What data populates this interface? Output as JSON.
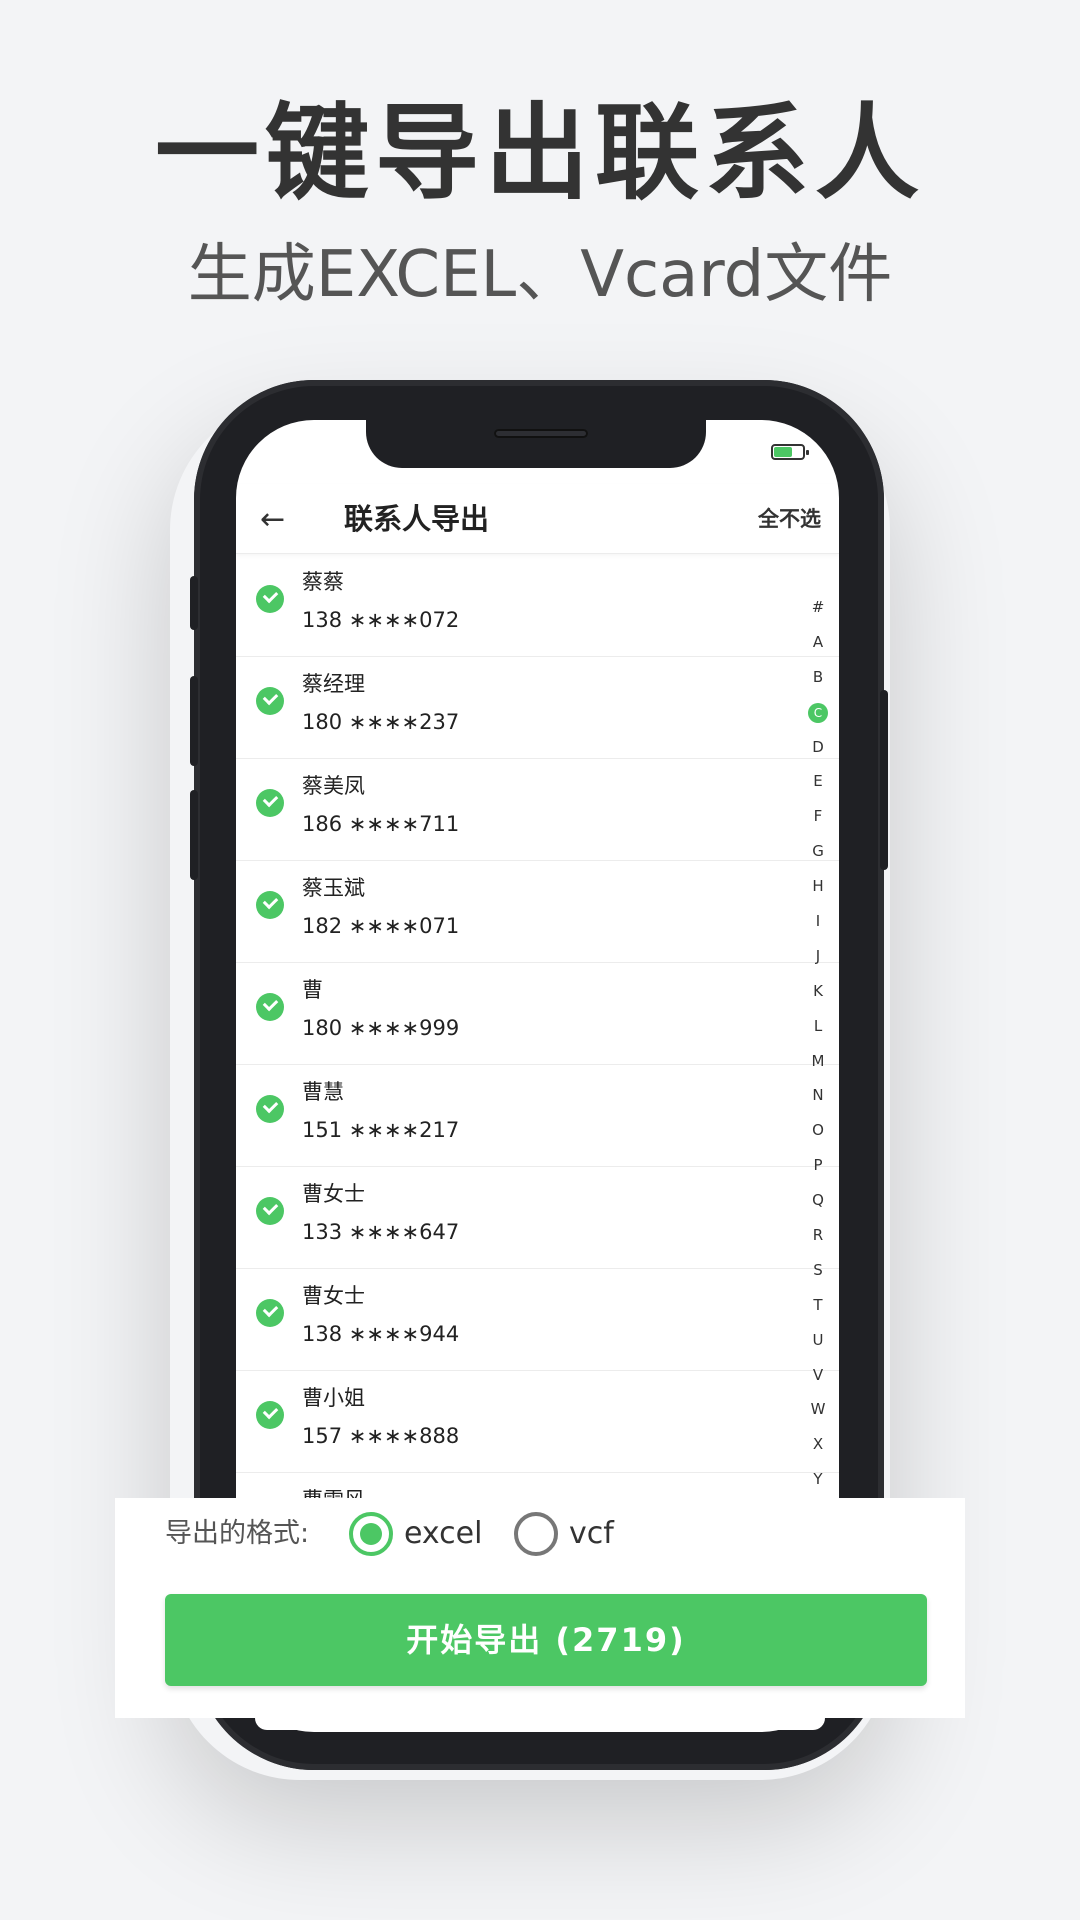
{
  "headline": "一键导出联系人",
  "subline": "生成EXCEL、Vcard文件",
  "app": {
    "title": "联系人导出",
    "back_icon": "←",
    "deselect_all": "全不选"
  },
  "contacts": [
    {
      "name": "蔡蔡",
      "phone": "138 ∗∗∗∗072"
    },
    {
      "name": "蔡经理",
      "phone": "180 ∗∗∗∗237"
    },
    {
      "name": "蔡美凤",
      "phone": "186 ∗∗∗∗711"
    },
    {
      "name": "蔡玉斌",
      "phone": "182 ∗∗∗∗071"
    },
    {
      "name": "曹",
      "phone": "180 ∗∗∗∗999"
    },
    {
      "name": "曹慧",
      "phone": "151 ∗∗∗∗217"
    },
    {
      "name": "曹女士",
      "phone": "133 ∗∗∗∗647"
    },
    {
      "name": "曹女士",
      "phone": "138 ∗∗∗∗944"
    },
    {
      "name": "曹小姐",
      "phone": "157 ∗∗∗∗888"
    },
    {
      "name": "曹雪风",
      "phone": ""
    }
  ],
  "index_letters": [
    "#",
    "A",
    "B",
    "C",
    "D",
    "E",
    "F",
    "G",
    "H",
    "I",
    "J",
    "K",
    "L",
    "M",
    "N",
    "O",
    "P",
    "Q",
    "R",
    "S",
    "T",
    "U",
    "V",
    "W",
    "X",
    "Y"
  ],
  "index_active": "C",
  "export": {
    "format_label": "导出的格式:",
    "option_excel": "excel",
    "option_vcf": "vcf",
    "selected": "excel",
    "button_label": "开始导出 (2719)"
  },
  "colors": {
    "accent": "#4cc764",
    "background": "#f3f4f6",
    "phone_body": "#1f2024"
  }
}
